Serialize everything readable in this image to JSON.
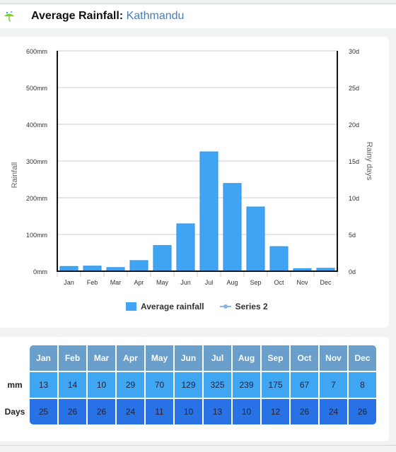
{
  "header": {
    "title": "Average Rainfall:",
    "city": "Kathmandu",
    "icon": "umbrella-icon"
  },
  "chart_data": {
    "type": "bar",
    "title": "",
    "categories": [
      "Jan",
      "Feb",
      "Mar",
      "Apr",
      "May",
      "Jun",
      "Jul",
      "Aug",
      "Sep",
      "Oct",
      "Nov",
      "Dec"
    ],
    "series": [
      {
        "name": "Average rainfall",
        "type": "bar",
        "axis": "left",
        "color": "#3fa4f3",
        "values": [
          13,
          14,
          10,
          29,
          70,
          129,
          325,
          239,
          175,
          67,
          7,
          8
        ]
      },
      {
        "name": "Series 2",
        "type": "line",
        "axis": "right",
        "color": "#84b6e6",
        "values": []
      }
    ],
    "ylabel": "Rainfall",
    "y2label": "Rainy days",
    "ylim": [
      0,
      600
    ],
    "y2lim": [
      0,
      30
    ],
    "yticks": [
      "0mm",
      "100mm",
      "200mm",
      "300mm",
      "400mm",
      "500mm",
      "600mm"
    ],
    "y2ticks": [
      "0d",
      "5d",
      "10d",
      "15d",
      "20d",
      "25d",
      "30d"
    ],
    "grid": true,
    "legend": "bottom"
  },
  "table": {
    "months": [
      "Jan",
      "Feb",
      "Mar",
      "Apr",
      "May",
      "Jun",
      "Jul",
      "Aug",
      "Sep",
      "Oct",
      "Nov",
      "Dec"
    ],
    "rows": [
      {
        "label": "mm",
        "values": [
          "13",
          "14",
          "10",
          "29",
          "70",
          "129",
          "325",
          "239",
          "175",
          "67",
          "7",
          "8"
        ]
      },
      {
        "label": "Days",
        "values": [
          "25",
          "26",
          "26",
          "24",
          "11",
          "10",
          "13",
          "10",
          "12",
          "26",
          "24",
          "26"
        ]
      }
    ]
  }
}
